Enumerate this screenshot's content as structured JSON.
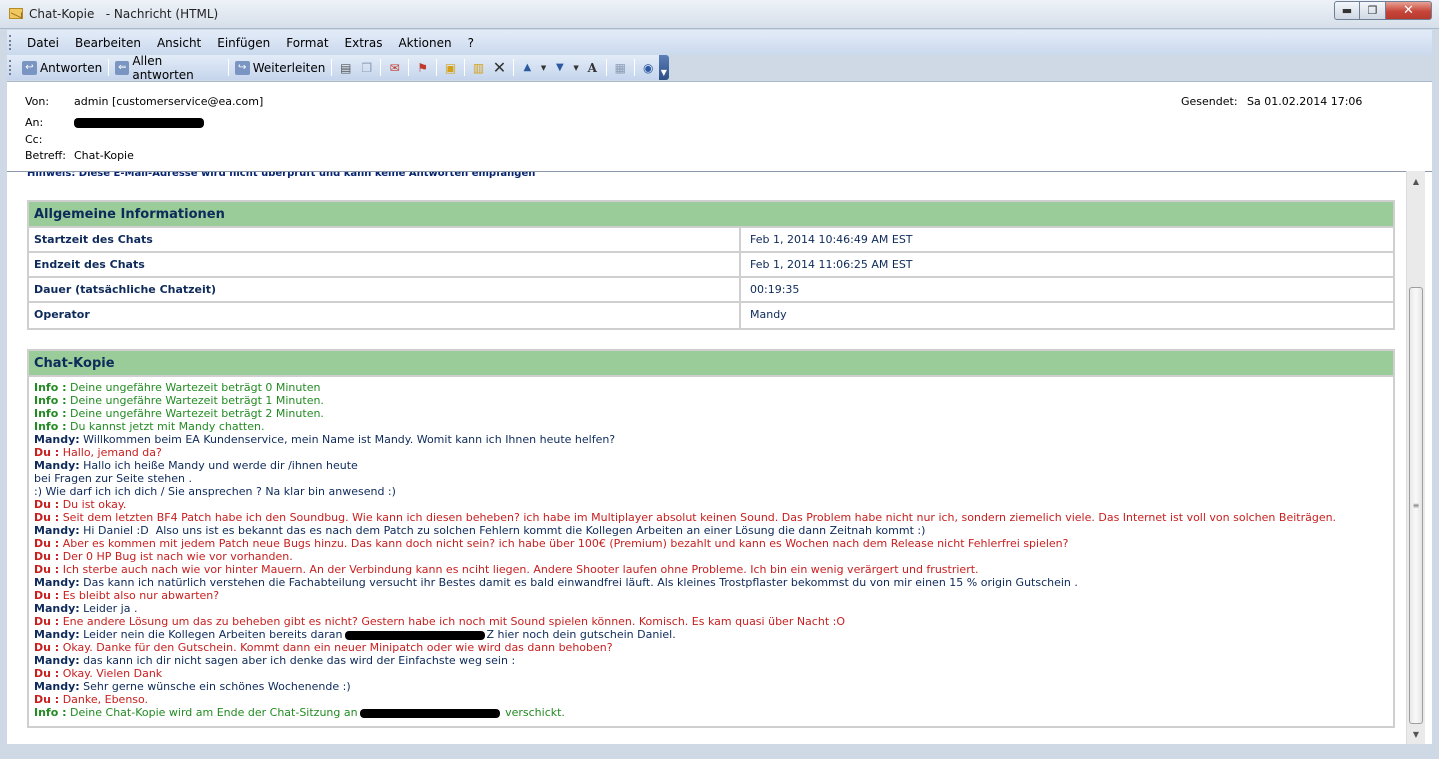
{
  "window": {
    "title": "Chat-Kopie   - Nachricht (HTML)",
    "buttons": {
      "minimize": "▬",
      "maximize": "❐",
      "close": "✕"
    }
  },
  "menu": [
    "Datei",
    "Bearbeiten",
    "Ansicht",
    "Einfügen",
    "Format",
    "Extras",
    "Aktionen",
    "?"
  ],
  "toolbar": {
    "reply": "Antworten",
    "reply_all": "Allen antworten",
    "forward": "Weiterleiten"
  },
  "header": {
    "from_label": "Von:",
    "from_value": "admin [customerservice@ea.com]",
    "to_label": "An:",
    "cc_label": "Cc:",
    "subject_label": "Betreff:",
    "subject_value": "Chat-Kopie",
    "sent_label": "Gesendet:",
    "sent_value": "Sa 01.02.2014 17:06"
  },
  "notice": "Hinweis: Diese E-Mail-Adresse wird nicht überprüft und kann keine Antworten empfangen",
  "general_info": {
    "heading": "Allgemeine Informationen",
    "rows": [
      {
        "label": "Startzeit des Chats",
        "value": "Feb 1, 2014 10:46:49 AM EST"
      },
      {
        "label": "Endzeit des Chats",
        "value": "Feb 1, 2014 11:06:25 AM EST"
      },
      {
        "label": "Dauer (tatsächliche Chatzeit)",
        "value": "00:19:35"
      },
      {
        "label": "Operator",
        "value": "Mandy"
      }
    ]
  },
  "chat": {
    "heading": "Chat-Kopie",
    "colors": {
      "info": "#228b22",
      "mandy": "#0d2a5a",
      "du": "#c81e1e"
    },
    "lines": [
      {
        "speaker": "Info :",
        "role": "info",
        "text": " Deine ungefähre Wartezeit beträgt 0 Minuten"
      },
      {
        "speaker": "Info :",
        "role": "info",
        "text": " Deine ungefähre Wartezeit beträgt 1 Minuten."
      },
      {
        "speaker": "Info :",
        "role": "info",
        "text": " Deine ungefähre Wartezeit beträgt 2 Minuten."
      },
      {
        "speaker": "Info :",
        "role": "info",
        "text": " Du kannst jetzt mit Mandy chatten."
      },
      {
        "speaker": "Mandy:",
        "role": "mandy",
        "text": " Willkommen beim EA Kundenservice, mein Name ist Mandy. Womit kann ich Ihnen heute helfen?"
      },
      {
        "speaker": "Du :",
        "role": "du",
        "text": " Hallo, jemand da?"
      },
      {
        "speaker": "Mandy:",
        "role": "mandy",
        "text": " Hallo ich heiße Mandy und werde dir /ihnen heute"
      },
      {
        "speaker": "",
        "role": "mandy",
        "text": "bei Fragen zur Seite stehen ."
      },
      {
        "speaker": "",
        "role": "mandy",
        "text": ":) Wie darf ich ich dich / Sie ansprechen ? Na klar bin anwesend :)"
      },
      {
        "speaker": "Du :",
        "role": "du",
        "text": " Du ist okay."
      },
      {
        "speaker": "Du :",
        "role": "du",
        "text": " Seit dem letzten BF4 Patch habe ich den Soundbug. Wie kann ich diesen beheben? ich habe im Multiplayer absolut keinen Sound. Das Problem habe nicht nur ich, sondern ziemelich viele. Das Internet ist voll von solchen Beiträgen."
      },
      {
        "speaker": "Mandy:",
        "role": "mandy",
        "text": " Hi Daniel :D  Also uns ist es bekannt das es nach dem Patch zu solchen Fehlern kommt die Kollegen Arbeiten an einer Lösung die dann Zeitnah kommt :)"
      },
      {
        "speaker": "Du :",
        "role": "du",
        "text": " Aber es kommen mit jedem Patch neue Bugs hinzu. Das kann doch nicht sein? ich habe über 100€ (Premium) bezahlt und kann es Wochen nach dem Release nicht Fehlerfrei spielen?"
      },
      {
        "speaker": "Du :",
        "role": "du",
        "text": " Der 0 HP Bug ist nach wie vor vorhanden."
      },
      {
        "speaker": "Du :",
        "role": "du",
        "text": " Ich sterbe auch nach wie vor hinter Mauern. An der Verbindung kann es nciht liegen. Andere Shooter laufen ohne Probleme. Ich bin ein wenig verärgert und frustriert."
      },
      {
        "speaker": "Mandy:",
        "role": "mandy",
        "text": " Das kann ich natürlich verstehen die Fachabteilung versucht ihr Bestes damit es bald einwandfrei läuft. Als kleines Trostpflaster bekommst du von mir einen 15 % origin Gutschein ."
      },
      {
        "speaker": "Du :",
        "role": "du",
        "text": " Es bleibt also nur abwarten?"
      },
      {
        "speaker": "Mandy:",
        "role": "mandy",
        "text": " Leider ja ."
      },
      {
        "speaker": "Du :",
        "role": "du",
        "text": " Ene andere Lösung um das zu beheben gibt es nicht? Gestern habe ich noch mit Sound spielen können. Komisch. Es kam quasi über Nacht :O"
      },
      {
        "speaker": "Mandy:",
        "role": "mandy",
        "text": " Leider nein die Kollegen Arbeiten bereits daran",
        "redacted": true,
        "text_after": "Z hier noch dein gutschein Daniel."
      },
      {
        "speaker": "Du :",
        "role": "du",
        "text": " Okay. Danke für den Gutschein. Kommt dann ein neuer Minipatch oder wie wird das dann behoben?"
      },
      {
        "speaker": "Mandy:",
        "role": "mandy",
        "text": " das kann ich dir nicht sagen aber ich denke das wird der Einfachste weg sein :"
      },
      {
        "speaker": "Du :",
        "role": "du",
        "text": " Okay. Vielen Dank"
      },
      {
        "speaker": "Mandy:",
        "role": "mandy",
        "text": " Sehr gerne wünsche ein schönes Wochenende :)"
      },
      {
        "speaker": "Du :",
        "role": "du",
        "text": " Danke, Ebenso."
      },
      {
        "speaker": "Info :",
        "role": "info",
        "text": " Deine Chat-Kopie wird am Ende der Chat-Sitzung an",
        "redacted": true,
        "text_after": " verschickt."
      }
    ]
  }
}
